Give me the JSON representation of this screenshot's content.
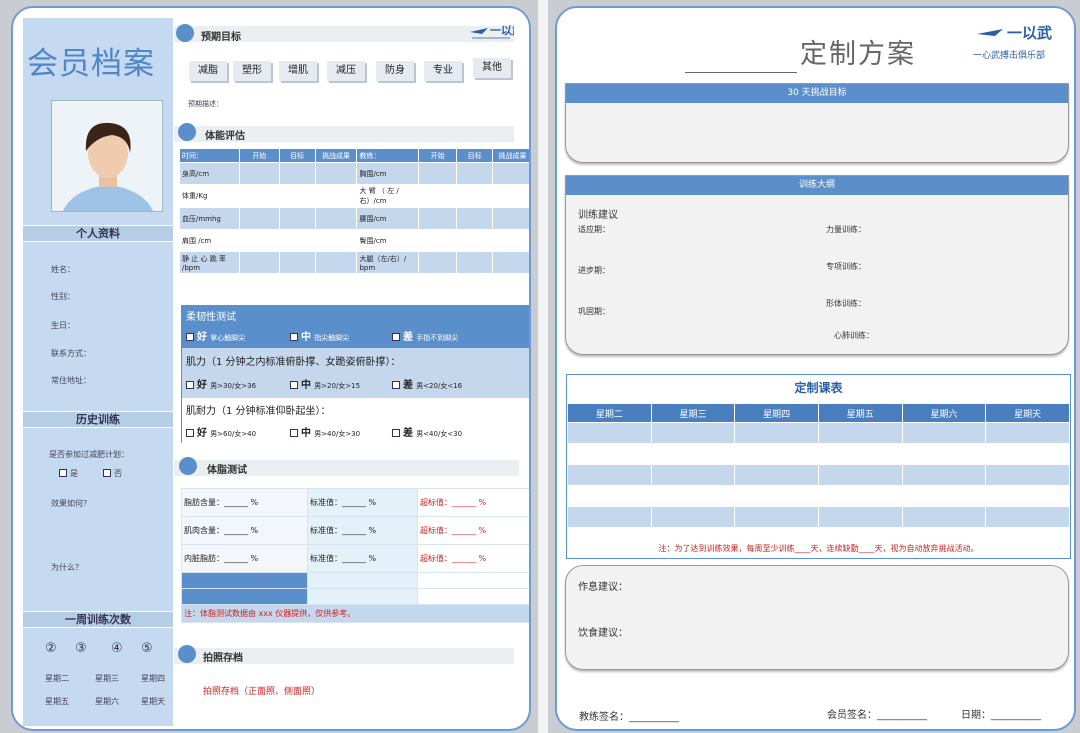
{
  "left": {
    "title": "会员档案",
    "personal": {
      "heading": "个人资料",
      "fields": [
        "姓名：",
        "性别：",
        "生日：",
        "联系方式：",
        "常住地址："
      ]
    },
    "history": {
      "heading": "历史训练",
      "question": "是否参加过减肥计划：",
      "yes": "是",
      "no": "否",
      "effect": "效果如何？",
      "why": "为什么？"
    },
    "weekly": {
      "heading": "一周训练次数",
      "counts": [
        "②",
        "③",
        "④",
        "⑤"
      ],
      "days_row1": [
        "星期二",
        "星期三",
        "星期四"
      ],
      "days_row2": [
        "星期五",
        "星期六",
        "星期天"
      ]
    },
    "goal": {
      "heading": "预期目标",
      "options": [
        "减脂",
        "塑形",
        "增肌",
        "减压",
        "防身",
        "专业",
        "其他"
      ],
      "desc": "预期描述："
    },
    "fitness": {
      "heading": "体能评估",
      "header": [
        "时间：",
        "开始",
        "目标",
        "挑战成果",
        "教练：",
        "开始",
        "目标",
        "挑战成果"
      ],
      "rows": [
        [
          "身高/cm",
          "胸围/cm"
        ],
        [
          "体重/Kg",
          "大 臂 （ 左 / 右）/cm"
        ],
        [
          "血压/mmhg",
          "腰围/cm"
        ],
        [
          "肩围 /cm",
          "臀围/cm"
        ],
        [
          "静 止 心 跳 率 /bpm",
          "大腿（左/右）/ bpm"
        ]
      ]
    },
    "flex": {
      "title": "柔韧性测试",
      "opt1": [
        {
          "k": "好",
          "n": "掌心触脚尖"
        },
        {
          "k": "中",
          "n": "指尖触脚尖"
        },
        {
          "k": "差",
          "n": "手指不到脚尖"
        }
      ],
      "strength_title": "肌力（1 分钟之内标准俯卧撑、女跪姿俯卧撑）：",
      "opt2": [
        {
          "k": "好",
          "n": "男>30/女>36"
        },
        {
          "k": "中",
          "n": "男>20/女>15"
        },
        {
          "k": "差",
          "n": "男<20/女<16"
        }
      ],
      "endurance_title": "肌耐力（1 分钟标准仰卧起坐）：",
      "opt3": [
        {
          "k": "好",
          "n": "男>60/女>40"
        },
        {
          "k": "中",
          "n": "男>40/女>30"
        },
        {
          "k": "差",
          "n": "男<40/女<30"
        }
      ]
    },
    "fat": {
      "heading": "体脂测试",
      "rows": [
        [
          "脂肪含量：______ %",
          "标准值：______ %",
          "超标值：______ %"
        ],
        [
          "肌肉含量：______ %",
          "标准值：______ %",
          "超标值：______ %"
        ],
        [
          "内脏脂肪：______ %",
          "标准值：______ %",
          "超标值：______ %"
        ]
      ],
      "note": "注：体脂测试数据由 xxx 仪器提供，仅供参考。"
    },
    "photo_archive": {
      "heading": "拍照存档",
      "text": "拍照存档（正面照、侧面照）"
    }
  },
  "right": {
    "title": "定制方案",
    "logo_text": "一心武搏击俱乐部",
    "challenge": "30 天挑战目标",
    "outline": {
      "heading": "训练大纲",
      "sub": "训练建议",
      "left": [
        "适应期：",
        "进步期：",
        "巩固期："
      ],
      "right": [
        "力量训练：",
        "专项训练：",
        "形体训练：",
        "心肺训练："
      ]
    },
    "schedule": {
      "title": "定制课表",
      "days": [
        "星期二",
        "星期三",
        "星期四",
        "星期五",
        "星期六",
        "星期天"
      ],
      "note": "注：为了达到训练效果，每周至少训练____天，连续缺勤____天，视为自动放弃挑战活动。"
    },
    "advice": {
      "rest": "作息建议：",
      "diet": "饮食建议："
    },
    "sign": {
      "coach": "教练签名：__________",
      "member": "会员签名：__________",
      "date": "日期：__________"
    }
  },
  "colors": {
    "accent": "#5b8fcb",
    "sidebar": "#c5daf0",
    "title": "#4f86c6",
    "warning": "#cc2222"
  }
}
